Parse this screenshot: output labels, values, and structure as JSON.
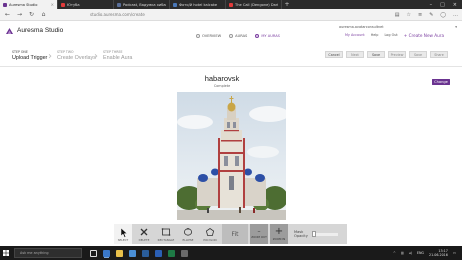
{
  "browser": {
    "tabs": [
      {
        "label": "Auresma Studio",
        "favicon_color": "#6a3390",
        "active": true
      },
      {
        "label": "Ютуба",
        "favicon_color": "#e23b3b",
        "active": false
      },
      {
        "label": "Podcast, Вадумка хибасика",
        "favicon_color": "#5a6f99",
        "active": false
      },
      {
        "label": "Фото/й hotel kalcake",
        "favicon_color": "#4a78b8",
        "active": false
      },
      {
        "label": "The Call (Dengone) Daria M",
        "favicon_color": "#e23b3b",
        "active": false
      }
    ],
    "url": "studio.auresma.com/create"
  },
  "app": {
    "brand": "Auresma Studio",
    "accent": "#6a3390",
    "nav": [
      {
        "label": "OVERVIEW",
        "active": false
      },
      {
        "label": "AURAS",
        "active": false
      },
      {
        "label": "MY AURAS",
        "active": true
      }
    ],
    "user": {
      "email": "auresma.avatarconsultnet",
      "account": "My Account",
      "help": "Help",
      "logout": "Log Out",
      "create": "Create New Aura"
    }
  },
  "steps": [
    {
      "num": "STEP ONE",
      "name": "Upload Trigger",
      "current": true
    },
    {
      "num": "STEP TWO",
      "name": "Create Overlays",
      "current": false
    },
    {
      "num": "STEP THREE",
      "name": "Enable Aura",
      "current": false
    }
  ],
  "actions": [
    {
      "label": "Cancel"
    },
    {
      "label": "Next"
    },
    {
      "label": "Save"
    },
    {
      "label": "Preview"
    },
    {
      "label": "Save"
    },
    {
      "label": "Share"
    }
  ],
  "trigger": {
    "title": "habarovsk",
    "status": "Complete",
    "change_label": "Change"
  },
  "toolbar": {
    "tools": [
      {
        "label": "SELECT",
        "icon": "cursor-icon"
      },
      {
        "label": "DELETE",
        "icon": "delete-x-icon"
      },
      {
        "label": "RECTANGLE",
        "icon": "rectangle-icon"
      },
      {
        "label": "ELLIPSE",
        "icon": "ellipse-icon"
      },
      {
        "label": "POLYGON",
        "icon": "polygon-icon"
      }
    ],
    "fit_label": "Fit",
    "zoom_out_label": "ZOOM OUT",
    "zoom_in_label": "ZOOM IN",
    "mask_label": "Mask",
    "opacity_label": "Opacity"
  },
  "taskbar": {
    "search_placeholder": "Ask me anything",
    "language": "ENG",
    "time": "13:17",
    "date": "21.06.2016"
  }
}
